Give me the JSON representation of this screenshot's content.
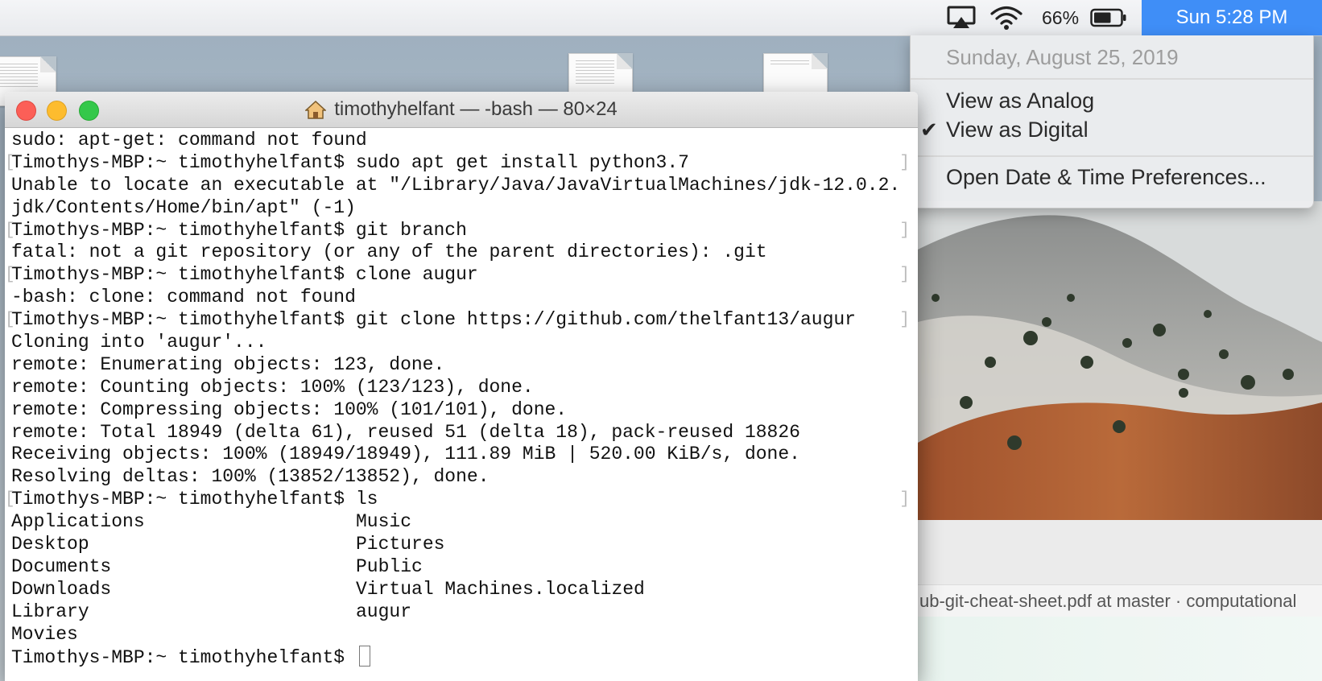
{
  "menubar": {
    "battery_percent": "66%",
    "clock": "Sun 5:28 PM",
    "battery_level": 0.66
  },
  "clock_menu": {
    "date": "Sunday, August 25, 2019",
    "items": [
      {
        "label": "View as Analog",
        "checked": false
      },
      {
        "label": "View as Digital",
        "checked": true
      },
      {
        "label": "Open Date & Time Preferences..."
      }
    ],
    "check_glyph": "✔"
  },
  "terminal": {
    "title": "timothyhelfant — -bash — 80×24",
    "lines": [
      "sudo: apt-get: command not found",
      "Timothys-MBP:~ timothyhelfant$ sudo apt get install python3.7",
      "Unable to locate an executable at \"/Library/Java/JavaVirtualMachines/jdk-12.0.2.",
      "jdk/Contents/Home/bin/apt\" (-1)",
      "Timothys-MBP:~ timothyhelfant$ git branch",
      "fatal: not a git repository (or any of the parent directories): .git",
      "Timothys-MBP:~ timothyhelfant$ clone augur",
      "-bash: clone: command not found",
      "Timothys-MBP:~ timothyhelfant$ git clone https://github.com/thelfant13/augur",
      "Cloning into 'augur'...",
      "remote: Enumerating objects: 123, done.",
      "remote: Counting objects: 100% (123/123), done.",
      "remote: Compressing objects: 100% (101/101), done.",
      "remote: Total 18949 (delta 61), reused 51 (delta 18), pack-reused 18826",
      "Receiving objects: 100% (18949/18949), 111.89 MiB | 520.00 KiB/s, done.",
      "Resolving deltas: 100% (13852/13852), done.",
      "Timothys-MBP:~ timothyhelfant$ ls"
    ],
    "ls_left": [
      "Applications",
      "Desktop",
      "Documents",
      "Downloads",
      "Library",
      "Movies"
    ],
    "ls_right": [
      "Music",
      "Pictures",
      "Public",
      "Virtual Machines.localized",
      "augur"
    ],
    "final_prompt": "Timothys-MBP:~ timothyhelfant$ "
  },
  "background_browser": {
    "tab_title": "ub-git-cheat-sheet.pdf at master · computational"
  },
  "colors": {
    "menubar_highlight": "#3f8ef7",
    "close": "#fc5f57",
    "minimize": "#fdbc2e",
    "zoom": "#34c84a"
  }
}
